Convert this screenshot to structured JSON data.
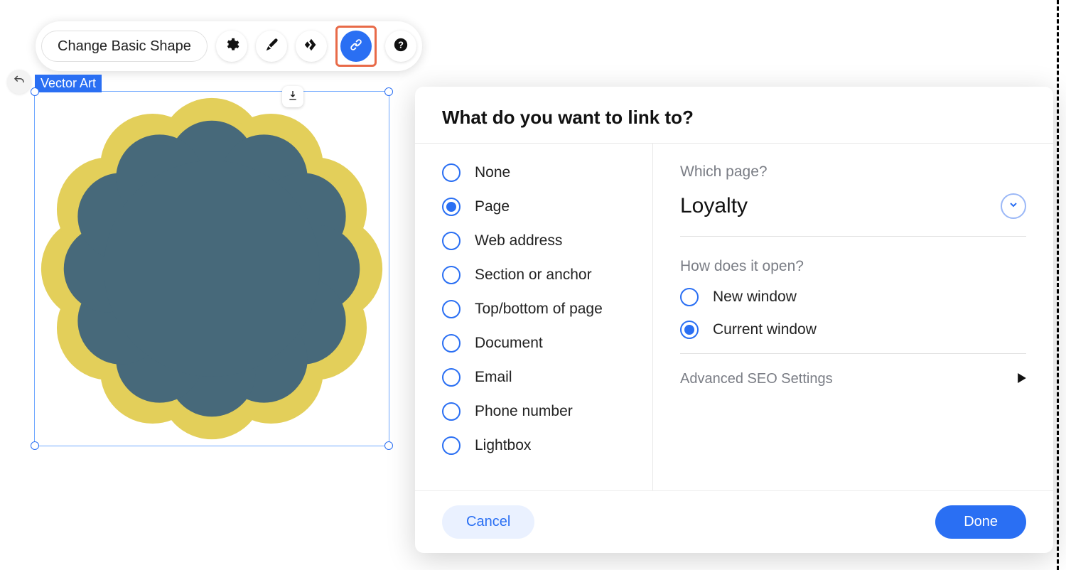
{
  "toolbar": {
    "change_shape": "Change Basic Shape"
  },
  "selection": {
    "tag": "Vector Art"
  },
  "dialog": {
    "title": "What do you want to link to?",
    "link_types": {
      "selected": "Page",
      "options": [
        "None",
        "Page",
        "Web address",
        "Section or anchor",
        "Top/bottom of page",
        "Document",
        "Email",
        "Phone number",
        "Lightbox"
      ]
    },
    "page": {
      "label": "Which page?",
      "value": "Loyalty"
    },
    "open": {
      "label": "How does it open?",
      "selected": "Current window",
      "options": [
        "New window",
        "Current window"
      ]
    },
    "advanced": "Advanced SEO Settings",
    "cancel": "Cancel",
    "done": "Done"
  }
}
